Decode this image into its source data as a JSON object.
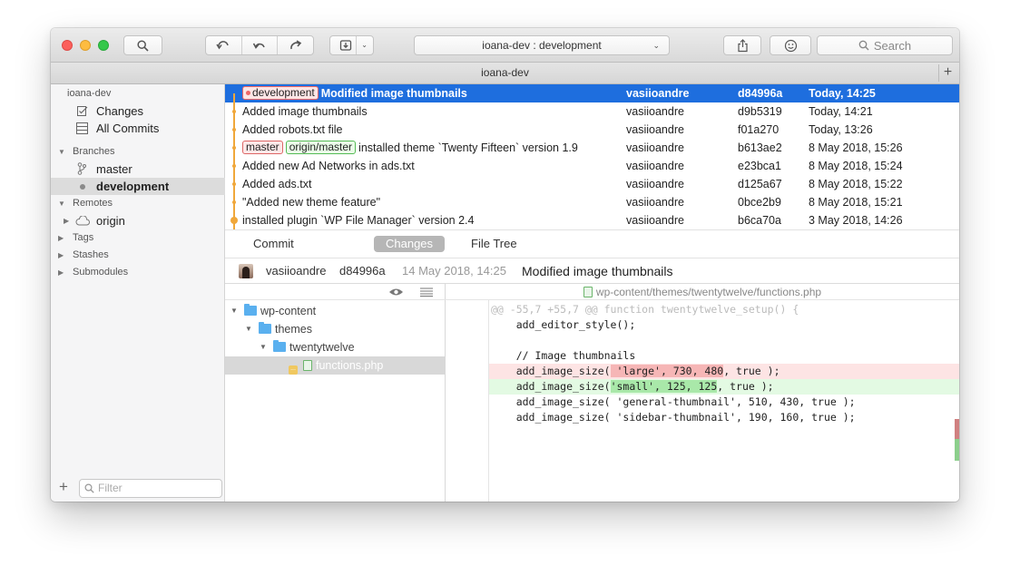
{
  "toolbar": {
    "repo_selector": "ioana-dev :  development",
    "search_label": "Search"
  },
  "tabbar": {
    "title": "ioana-dev",
    "plus": "+"
  },
  "sidebar": {
    "repo": "ioana-dev",
    "changes": "Changes",
    "all_commits": "All Commits",
    "branches_header": "Branches",
    "branches": [
      "master",
      "development"
    ],
    "remotes_header": "Remotes",
    "remotes": [
      "origin"
    ],
    "tags_header": "Tags",
    "stashes_header": "Stashes",
    "submodules_header": "Submodules",
    "filter_placeholder": "Filter",
    "add": "+"
  },
  "history": [
    {
      "tags": [
        "development"
      ],
      "message": "Modified image thumbnails",
      "author": "vasiioandre",
      "sha": "d84996a",
      "date": "Today, 14:25"
    },
    {
      "tags": [],
      "message": "Added image thumbnails",
      "author": "vasiioandre",
      "sha": "d9b5319",
      "date": "Today, 14:21"
    },
    {
      "tags": [],
      "message": "Added robots.txt file",
      "author": "vasiioandre",
      "sha": "f01a270",
      "date": "Today, 13:26"
    },
    {
      "tags": [
        "master",
        "origin/master"
      ],
      "message": "installed theme `Twenty Fifteen` version 1.9",
      "author": "vasiioandre",
      "sha": "b613ae2",
      "date": "8 May 2018, 15:26"
    },
    {
      "tags": [],
      "message": "Added new Ad Networks in ads.txt",
      "author": "vasiioandre",
      "sha": "e23bca1",
      "date": "8 May 2018, 15:24"
    },
    {
      "tags": [],
      "message": "Added ads.txt",
      "author": "vasiioandre",
      "sha": "d125a67",
      "date": "8 May 2018, 15:22"
    },
    {
      "tags": [],
      "message": "\"Added new theme feature\"",
      "author": "vasiioandre",
      "sha": "0bce2b9",
      "date": "8 May 2018, 15:21"
    },
    {
      "tags": [],
      "message": "installed plugin `WP File Manager` version 2.4",
      "author": "vasiioandre",
      "sha": "b6ca70a",
      "date": "3 May 2018, 14:26"
    }
  ],
  "modes": {
    "commit": "Commit",
    "changes": "Changes",
    "file_tree": "File Tree"
  },
  "commit_header": {
    "author": "vasiioandre",
    "sha": "d84996a",
    "date": "14 May 2018, 14:25",
    "message": "Modified image thumbnails"
  },
  "file_tree": {
    "root": "wp-content",
    "themes": "themes",
    "theme": "twentytwelve",
    "file": "functions.php",
    "file_status": "..."
  },
  "diff": {
    "path": "wp-content/themes/twentytwelve/functions.php",
    "hunk": "@@ -55,7 +55,7 @@ function twentytwelve_setup() {",
    "line1": "    add_editor_style();",
    "line3": "    // Image thumbnails",
    "del_pre": "    add_image_size(",
    "del_hl": " 'large', 730, 480",
    "del_post": ", true );",
    "add_pre": "    add_image_size(",
    "add_hl": "'small', 125, 125",
    "add_post": ", true );",
    "line6": "    add_image_size( 'general-thumbnail', 510, 430, true );",
    "line7": "    add_image_size( 'sidebar-thumbnail', 190, 160, true );"
  },
  "colors": {
    "selection": "#1e6ede",
    "graph": "#f0a73a",
    "deleted": "#fde4e4",
    "added": "#e3fae3"
  }
}
